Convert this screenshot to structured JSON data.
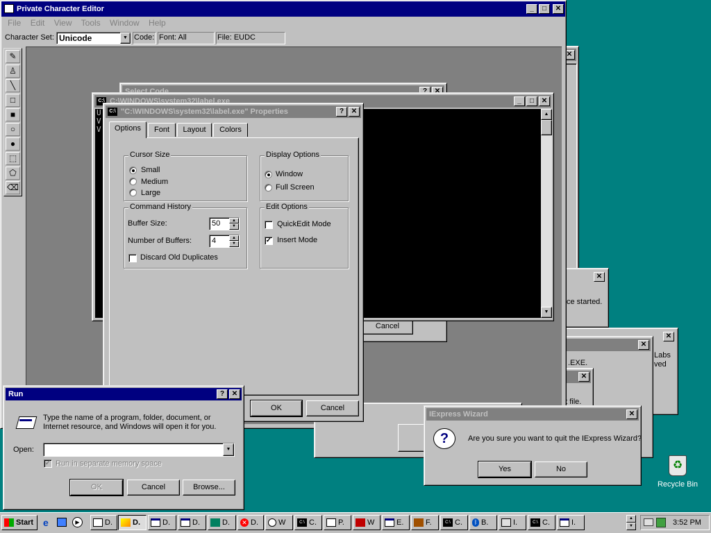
{
  "colors": {
    "desktop": "#008080",
    "active_title": "#000080",
    "inactive_title": "#808080"
  },
  "pce": {
    "title": "Private Character Editor",
    "menu": [
      "File",
      "Edit",
      "View",
      "Tools",
      "Window",
      "Help"
    ],
    "charset_label": "Character Set:",
    "charset_value": "Unicode",
    "code_label": "Code:",
    "font_label": "Font: All",
    "file_label": "File: EUDC",
    "tools": [
      "pencil-icon",
      "brush-icon",
      "line-icon",
      "hollow-rectangle-icon",
      "filled-rectangle-icon",
      "hollow-ellipse-icon",
      "filled-ellipse-icon",
      "rect-select-icon",
      "freeform-select-icon",
      "eraser-icon"
    ]
  },
  "select_code": {
    "title": "Select Code",
    "cancel_label": "Cancel"
  },
  "console": {
    "title": "C:\\WINDOWS\\system32\\label.exe",
    "lines": [
      "U",
      "V",
      "V"
    ]
  },
  "props": {
    "title": "\"C:\\WINDOWS\\system32\\label.exe\" Properties",
    "tabs": [
      "Options",
      "Font",
      "Layout",
      "Colors"
    ],
    "cursor_size": {
      "label": "Cursor Size",
      "options": [
        "Small",
        "Medium",
        "Large"
      ],
      "selected": "Small"
    },
    "display_options": {
      "label": "Display Options",
      "options": [
        "Window",
        "Full Screen"
      ],
      "selected": "Window"
    },
    "command_history": {
      "label": "Command History",
      "buffer_size_label": "Buffer Size:",
      "buffer_size": "50",
      "num_buffers_label": "Number of Buffers:",
      "num_buffers": "4",
      "discard_label": "Discard Old Duplicates"
    },
    "edit_options": {
      "label": "Edit Options",
      "quickedit_label": "QuickEdit Mode",
      "insert_label": "Insert Mode"
    },
    "ok_label": "OK",
    "cancel_label": "Cancel"
  },
  "bg_fragments": {
    "service": "ce started.",
    "labs": "Labs",
    "ved": "ved",
    "exe": ".EXE.",
    "file": "nt file."
  },
  "run": {
    "title": "Run",
    "description": "Type the name of a program, folder, document, or Internet resource, and Windows will open it for you.",
    "open_label": "Open:",
    "open_value": "",
    "separate_memory_label": "Run in separate memory space",
    "ok_label": "OK",
    "cancel_label": "Cancel",
    "browse_label": "Browse..."
  },
  "iexpress": {
    "title": "IExpress Wizard",
    "message": "Are you sure you want to quit the IExpress Wizard?",
    "yes_label": "Yes",
    "no_label": "No"
  },
  "desktop": {
    "recycle_bin_label": "Recycle Bin"
  },
  "taskbar": {
    "start_label": "Start",
    "tasks": [
      {
        "label": "D.",
        "icon": "window-icon"
      },
      {
        "label": "D.",
        "icon": "paint-icon"
      },
      {
        "label": "D.",
        "icon": "window-icon"
      },
      {
        "label": "D.",
        "icon": "window-icon"
      },
      {
        "label": "D.",
        "icon": "app-icon"
      },
      {
        "label": "D.",
        "icon": "error-icon"
      },
      {
        "label": "W",
        "icon": "media-icon"
      },
      {
        "label": "C.",
        "icon": "console-icon"
      },
      {
        "label": "P.",
        "icon": "search-icon"
      },
      {
        "label": "W",
        "icon": "app-icon"
      },
      {
        "label": "E.",
        "icon": "window-icon"
      },
      {
        "label": "F.",
        "icon": "app-icon"
      },
      {
        "label": "C.",
        "icon": "console-icon"
      },
      {
        "label": "B.",
        "icon": "bluetooth-icon"
      },
      {
        "label": "I.",
        "icon": "app-icon"
      },
      {
        "label": "C.",
        "icon": "console-icon"
      },
      {
        "label": "I.",
        "icon": "window-icon"
      }
    ],
    "clock": "3:52 PM"
  }
}
